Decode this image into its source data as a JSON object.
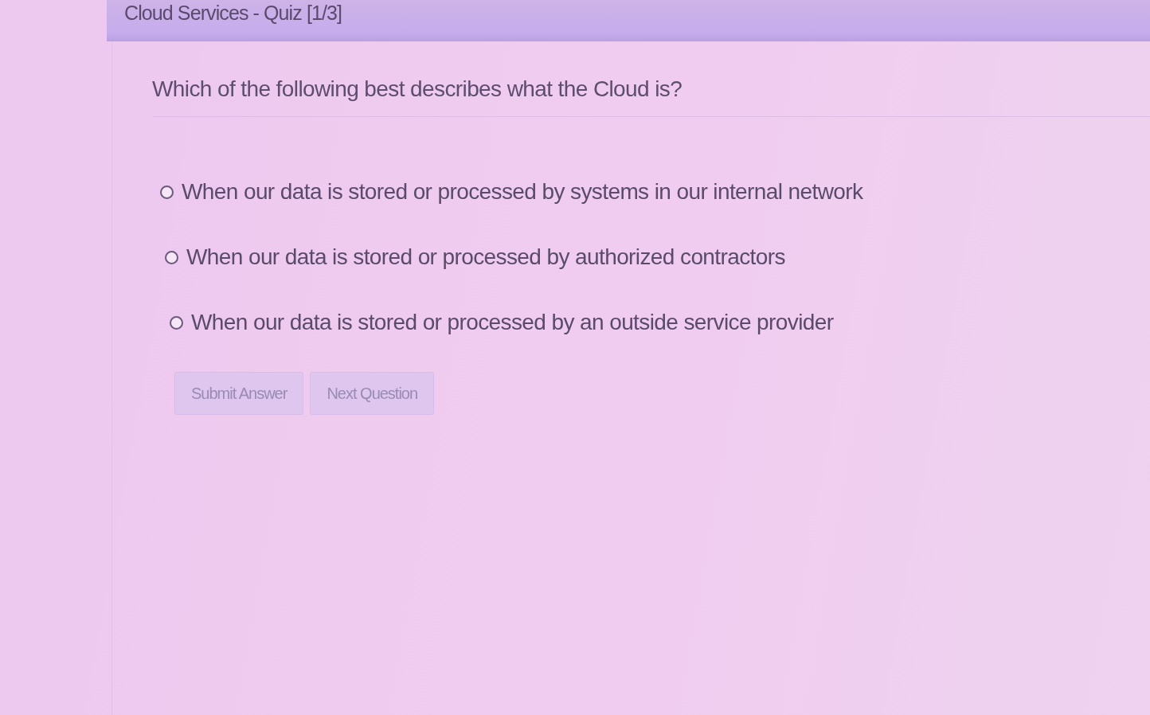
{
  "header": {
    "title": "Cloud Services - Quiz [1/3]"
  },
  "question": {
    "text": "Which of the following best describes what the Cloud is?",
    "options": [
      {
        "label": "When our data is stored or processed by systems in our internal network",
        "selected": false
      },
      {
        "label": "When our data is stored or processed by authorized contractors",
        "selected": false
      },
      {
        "label": "When our data is stored or processed by an outside service provider",
        "selected": false
      }
    ]
  },
  "buttons": [
    {
      "label": "Submit Answer",
      "disabled": true
    },
    {
      "label": "Next Question",
      "disabled": true
    }
  ]
}
